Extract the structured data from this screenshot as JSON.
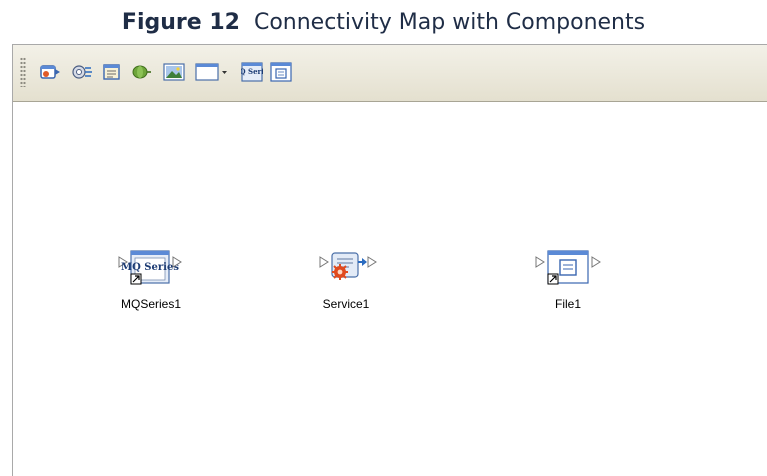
{
  "caption": {
    "label": "Figure 12",
    "title": "Connectivity Map with Components"
  },
  "toolbar": {
    "buttons": [
      {
        "icon": "external-application-icon"
      },
      {
        "icon": "service-icon"
      },
      {
        "icon": "scheduler-icon"
      },
      {
        "icon": "web-service-icon"
      },
      {
        "icon": "image-icon"
      },
      {
        "icon": "window-dropdown-icon"
      },
      {
        "icon": "mqseries-icon",
        "icon_text": "MQ Series"
      },
      {
        "icon": "file-icon"
      }
    ]
  },
  "canvas": {
    "components": [
      {
        "name": "MQSeries1",
        "icon": "mqseries-icon",
        "icon_text": "MQ Series"
      },
      {
        "name": "Service1",
        "icon": "service-icon"
      },
      {
        "name": "File1",
        "icon": "file-icon"
      }
    ]
  },
  "colors": {
    "toolbar_bg": "#ebe8da",
    "icon_blue": "#2a6bc0",
    "service_red": "#e04a1f",
    "text": "#000000"
  }
}
